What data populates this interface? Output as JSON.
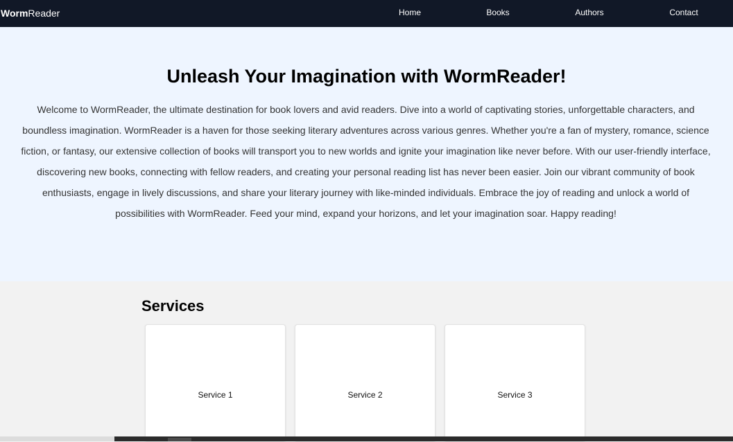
{
  "navbar": {
    "brand_bold": "Worm",
    "brand_regular": "Reader",
    "links": [
      "Home",
      "Books",
      "Authors",
      "Contact"
    ],
    "background": "#111827"
  },
  "hero": {
    "title": "Unleash Your Imagination with WormReader!",
    "text": "Welcome to WormReader, the ultimate destination for book lovers and avid readers. Dive into a world of captivating stories, unforgettable characters, and boundless imagination. WormReader is a haven for those seeking literary adventures across various genres. Whether you're a fan of mystery, romance, science fiction, or fantasy, our extensive collection of books will transport you to new worlds and ignite your imagination like never before. With our user-friendly interface, discovering new books, connecting with fellow readers, and creating your personal reading list has never been easier. Join our vibrant community of book enthusiasts, engage in lively discussions, and share your literary journey with like-minded individuals. Embrace the joy of reading and unlock a world of possibilities with WormReader. Feed your mind, expand your horizons, and let your imagination soar. Happy reading!",
    "background": "#eef5ff"
  },
  "services": {
    "title": "Services",
    "cards": [
      {
        "label": "Service 1"
      },
      {
        "label": "Service 2"
      },
      {
        "label": "Service 3"
      }
    ]
  }
}
